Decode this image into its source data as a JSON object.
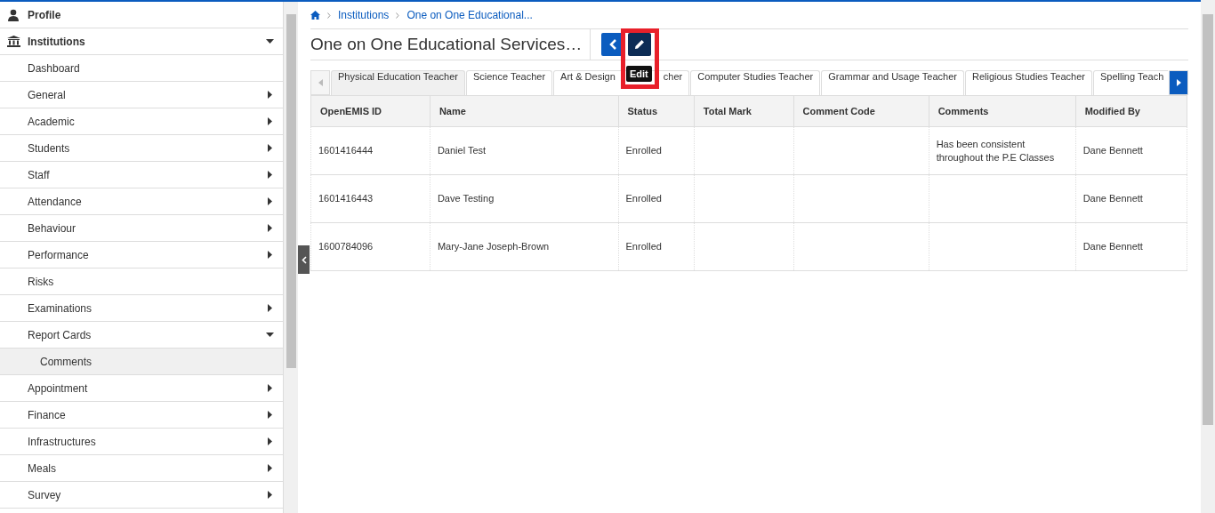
{
  "sidebar": {
    "items": [
      {
        "label": "Profile",
        "kind": "top"
      },
      {
        "label": "Institutions",
        "kind": "top",
        "expanded": true
      },
      {
        "label": "Dashboard",
        "kind": "sub"
      },
      {
        "label": "General",
        "kind": "sub",
        "expanded": false
      },
      {
        "label": "Academic",
        "kind": "sub",
        "expanded": false
      },
      {
        "label": "Students",
        "kind": "sub",
        "expanded": false
      },
      {
        "label": "Staff",
        "kind": "sub",
        "expanded": false
      },
      {
        "label": "Attendance",
        "kind": "sub",
        "expanded": false
      },
      {
        "label": "Behaviour",
        "kind": "sub",
        "expanded": false
      },
      {
        "label": "Performance",
        "kind": "sub",
        "expanded": false
      },
      {
        "label": "Risks",
        "kind": "sub"
      },
      {
        "label": "Examinations",
        "kind": "sub",
        "expanded": false
      },
      {
        "label": "Report Cards",
        "kind": "sub",
        "expanded": true
      },
      {
        "label": "Comments",
        "kind": "leaf",
        "selected": true
      },
      {
        "label": "Appointment",
        "kind": "sub",
        "expanded": false
      },
      {
        "label": "Finance",
        "kind": "sub",
        "expanded": false
      },
      {
        "label": "Infrastructures",
        "kind": "sub",
        "expanded": false
      },
      {
        "label": "Meals",
        "kind": "sub",
        "expanded": false
      },
      {
        "label": "Survey",
        "kind": "sub",
        "expanded": false
      }
    ]
  },
  "breadcrumb": [
    "Institutions",
    "One on One Educational..."
  ],
  "title": "One on One Educational Services…",
  "tooltip": "Edit",
  "tabs": [
    {
      "label": "Physical Education Teacher",
      "selected": true
    },
    {
      "label": "Science Teacher",
      "selected": false
    },
    {
      "label": "Art & Design",
      "label_end": "cher",
      "selected": false
    },
    {
      "label": "Computer Studies Teacher",
      "selected": false
    },
    {
      "label": "Grammar and Usage Teacher",
      "selected": false
    },
    {
      "label": "Religious Studies Teacher",
      "selected": false
    },
    {
      "label": "Spelling Teach",
      "selected": false
    }
  ],
  "table": {
    "columns": [
      "OpenEMIS ID",
      "Name",
      "Status",
      "Total Mark",
      "Comment Code",
      "Comments",
      "Modified By"
    ],
    "rows": [
      [
        "1601416444",
        "Daniel Test",
        "Enrolled",
        "",
        "",
        "Has been consistent throughout the P.E Classes",
        "Dane Bennett"
      ],
      [
        "1601416443",
        "Dave Testing",
        "Enrolled",
        "",
        "",
        "",
        "Dane Bennett"
      ],
      [
        "1600784096",
        "Mary-Jane Joseph-Brown",
        "Enrolled",
        "",
        "",
        "",
        "Dane Bennett"
      ]
    ]
  }
}
